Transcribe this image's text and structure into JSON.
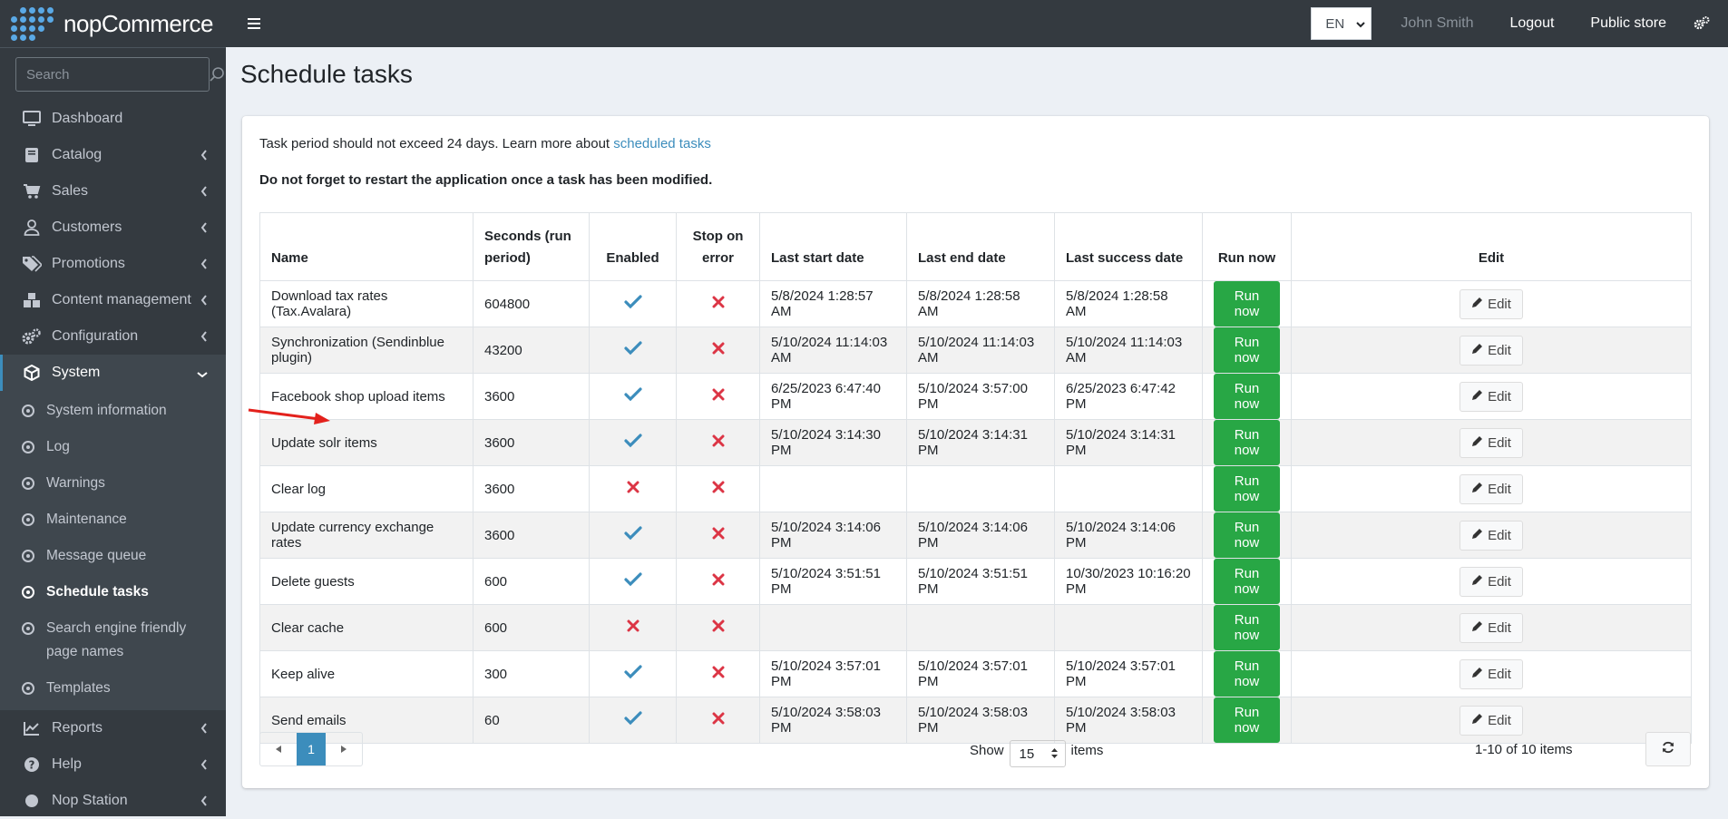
{
  "brand": {
    "name": "nopCommerce"
  },
  "sidebar": {
    "search_placeholder": "Search",
    "items": [
      {
        "label": "Dashboard",
        "icon": "monitor-icon"
      },
      {
        "label": "Catalog",
        "icon": "book-icon"
      },
      {
        "label": "Sales",
        "icon": "cart-icon"
      },
      {
        "label": "Customers",
        "icon": "user-icon"
      },
      {
        "label": "Promotions",
        "icon": "tags-icon"
      },
      {
        "label": "Content management",
        "icon": "cubes-icon"
      },
      {
        "label": "Configuration",
        "icon": "cogs-icon"
      },
      {
        "label": "System",
        "icon": "cube-icon"
      }
    ],
    "system_sub": [
      {
        "label": "System information"
      },
      {
        "label": "Log"
      },
      {
        "label": "Warnings"
      },
      {
        "label": "Maintenance"
      },
      {
        "label": "Message queue"
      },
      {
        "label": "Schedule tasks"
      },
      {
        "label": "Search engine friendly page names"
      },
      {
        "label": "Templates"
      }
    ],
    "bottom_items": [
      {
        "label": "Reports",
        "icon": "chart-icon"
      },
      {
        "label": "Help",
        "icon": "question-icon"
      },
      {
        "label": "Nop Station",
        "icon": "circle-icon"
      }
    ]
  },
  "topbar": {
    "language": "EN",
    "user": "John Smith",
    "logout": "Logout",
    "public_store": "Public store"
  },
  "page": {
    "title": "Schedule tasks",
    "info_text": "Task period should not exceed 24 days. Learn more about ",
    "info_link": "scheduled tasks",
    "warning": "Do not forget to restart the application once a task has been modified."
  },
  "table": {
    "headers": {
      "name": "Name",
      "seconds": "Seconds (run period)",
      "enabled": "Enabled",
      "stop": "Stop on error",
      "last_start": "Last start date",
      "last_end": "Last end date",
      "last_success": "Last success date",
      "run_now": "Run now",
      "edit": "Edit"
    },
    "run_label": "Run now",
    "edit_label": "Edit",
    "rows": [
      {
        "name": "Download tax rates (Tax.Avalara)",
        "seconds": "604800",
        "enabled": true,
        "stop": false,
        "last_start": "5/8/2024 1:28:57 AM",
        "last_end": "5/8/2024 1:28:58 AM",
        "last_success": "5/8/2024 1:28:58 AM"
      },
      {
        "name": "Synchronization (Sendinblue plugin)",
        "seconds": "43200",
        "enabled": true,
        "stop": false,
        "last_start": "5/10/2024 11:14:03 AM",
        "last_end": "5/10/2024 11:14:03 AM",
        "last_success": "5/10/2024 11:14:03 AM"
      },
      {
        "name": "Facebook shop upload items",
        "seconds": "3600",
        "enabled": true,
        "stop": false,
        "last_start": "6/25/2023 6:47:40 PM",
        "last_end": "5/10/2024 3:57:00 PM",
        "last_success": "6/25/2023 6:47:42 PM"
      },
      {
        "name": "Update solr items",
        "seconds": "3600",
        "enabled": true,
        "stop": false,
        "last_start": "5/10/2024 3:14:30 PM",
        "last_end": "5/10/2024 3:14:31 PM",
        "last_success": "5/10/2024 3:14:31 PM"
      },
      {
        "name": "Clear log",
        "seconds": "3600",
        "enabled": false,
        "stop": false,
        "last_start": "",
        "last_end": "",
        "last_success": ""
      },
      {
        "name": "Update currency exchange rates",
        "seconds": "3600",
        "enabled": true,
        "stop": false,
        "last_start": "5/10/2024 3:14:06 PM",
        "last_end": "5/10/2024 3:14:06 PM",
        "last_success": "5/10/2024 3:14:06 PM"
      },
      {
        "name": "Delete guests",
        "seconds": "600",
        "enabled": true,
        "stop": false,
        "last_start": "5/10/2024 3:51:51 PM",
        "last_end": "5/10/2024 3:51:51 PM",
        "last_success": "10/30/2023 10:16:20 PM"
      },
      {
        "name": "Clear cache",
        "seconds": "600",
        "enabled": false,
        "stop": false,
        "last_start": "",
        "last_end": "",
        "last_success": ""
      },
      {
        "name": "Keep alive",
        "seconds": "300",
        "enabled": true,
        "stop": false,
        "last_start": "5/10/2024 3:57:01 PM",
        "last_end": "5/10/2024 3:57:01 PM",
        "last_success": "5/10/2024 3:57:01 PM"
      },
      {
        "name": "Send emails",
        "seconds": "60",
        "enabled": true,
        "stop": false,
        "last_start": "5/10/2024 3:58:03 PM",
        "last_end": "5/10/2024 3:58:03 PM",
        "last_success": "5/10/2024 3:58:03 PM"
      }
    ]
  },
  "footer": {
    "current_page": "1",
    "show_label": "Show",
    "page_size": "15",
    "items_label": "items",
    "count_text": "1-10 of 10 items"
  },
  "colors": {
    "accent": "#3c8dbc",
    "success": "#28a745",
    "danger": "#dc3545",
    "sidebar": "#343a40"
  }
}
